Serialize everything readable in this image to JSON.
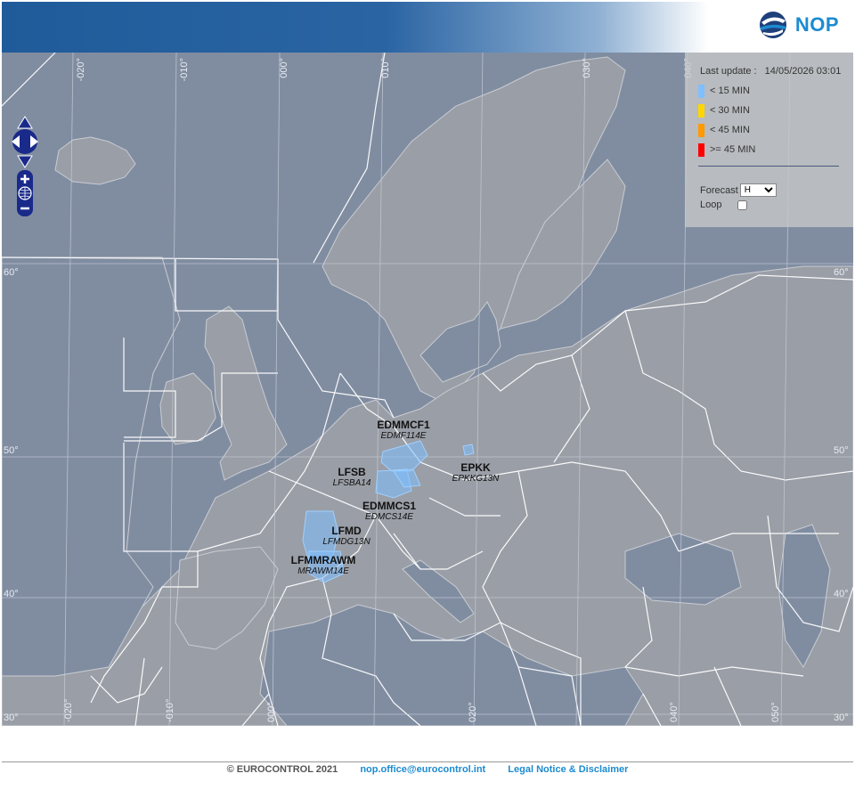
{
  "header": {
    "logo_text": "NOP"
  },
  "legend": {
    "last_update_label": "Last update :",
    "last_update_value": "14/05/2026 03:01",
    "items": [
      {
        "label": "< 15 MIN",
        "color": "#7fbfff"
      },
      {
        "label": "< 30 MIN",
        "color": "#ffd600"
      },
      {
        "label": "< 45 MIN",
        "color": "#ff9a00"
      },
      {
        "label": ">= 45 MIN",
        "color": "#ff0000"
      }
    ],
    "forecast_label": "Forecast",
    "forecast_value": "H",
    "loop_label": "Loop",
    "loop_checked": false
  },
  "map": {
    "latitude_labels": [
      "60°",
      "50°",
      "40°",
      "30°"
    ],
    "longitude_labels": [
      "-020°",
      "-010°",
      "000°",
      "010°",
      "020°",
      "030°",
      "040°",
      "050°"
    ],
    "regulations": [
      {
        "code": "EDMMCF1",
        "sub": "EDMF114E",
        "delay_class": "< 15 MIN"
      },
      {
        "code": "LFSB",
        "sub": "LFSBA14",
        "delay_class": "< 15 MIN"
      },
      {
        "code": "EPKK",
        "sub": "EPKKG13N",
        "delay_class": "< 15 MIN"
      },
      {
        "code": "EDMMCS1",
        "sub": "EDMCS14E",
        "delay_class": "< 15 MIN"
      },
      {
        "code": "LFMD",
        "sub": "LFMDG13N",
        "delay_class": "< 15 MIN"
      },
      {
        "code": "LFMMRAWM",
        "sub": "MRAWM14E",
        "delay_class": "< 15 MIN"
      }
    ]
  },
  "footer": {
    "copyright": "© EUROCONTROL 2021",
    "email": "nop.office@eurocontrol.int",
    "legal": "Legal Notice & Disclaimer"
  }
}
